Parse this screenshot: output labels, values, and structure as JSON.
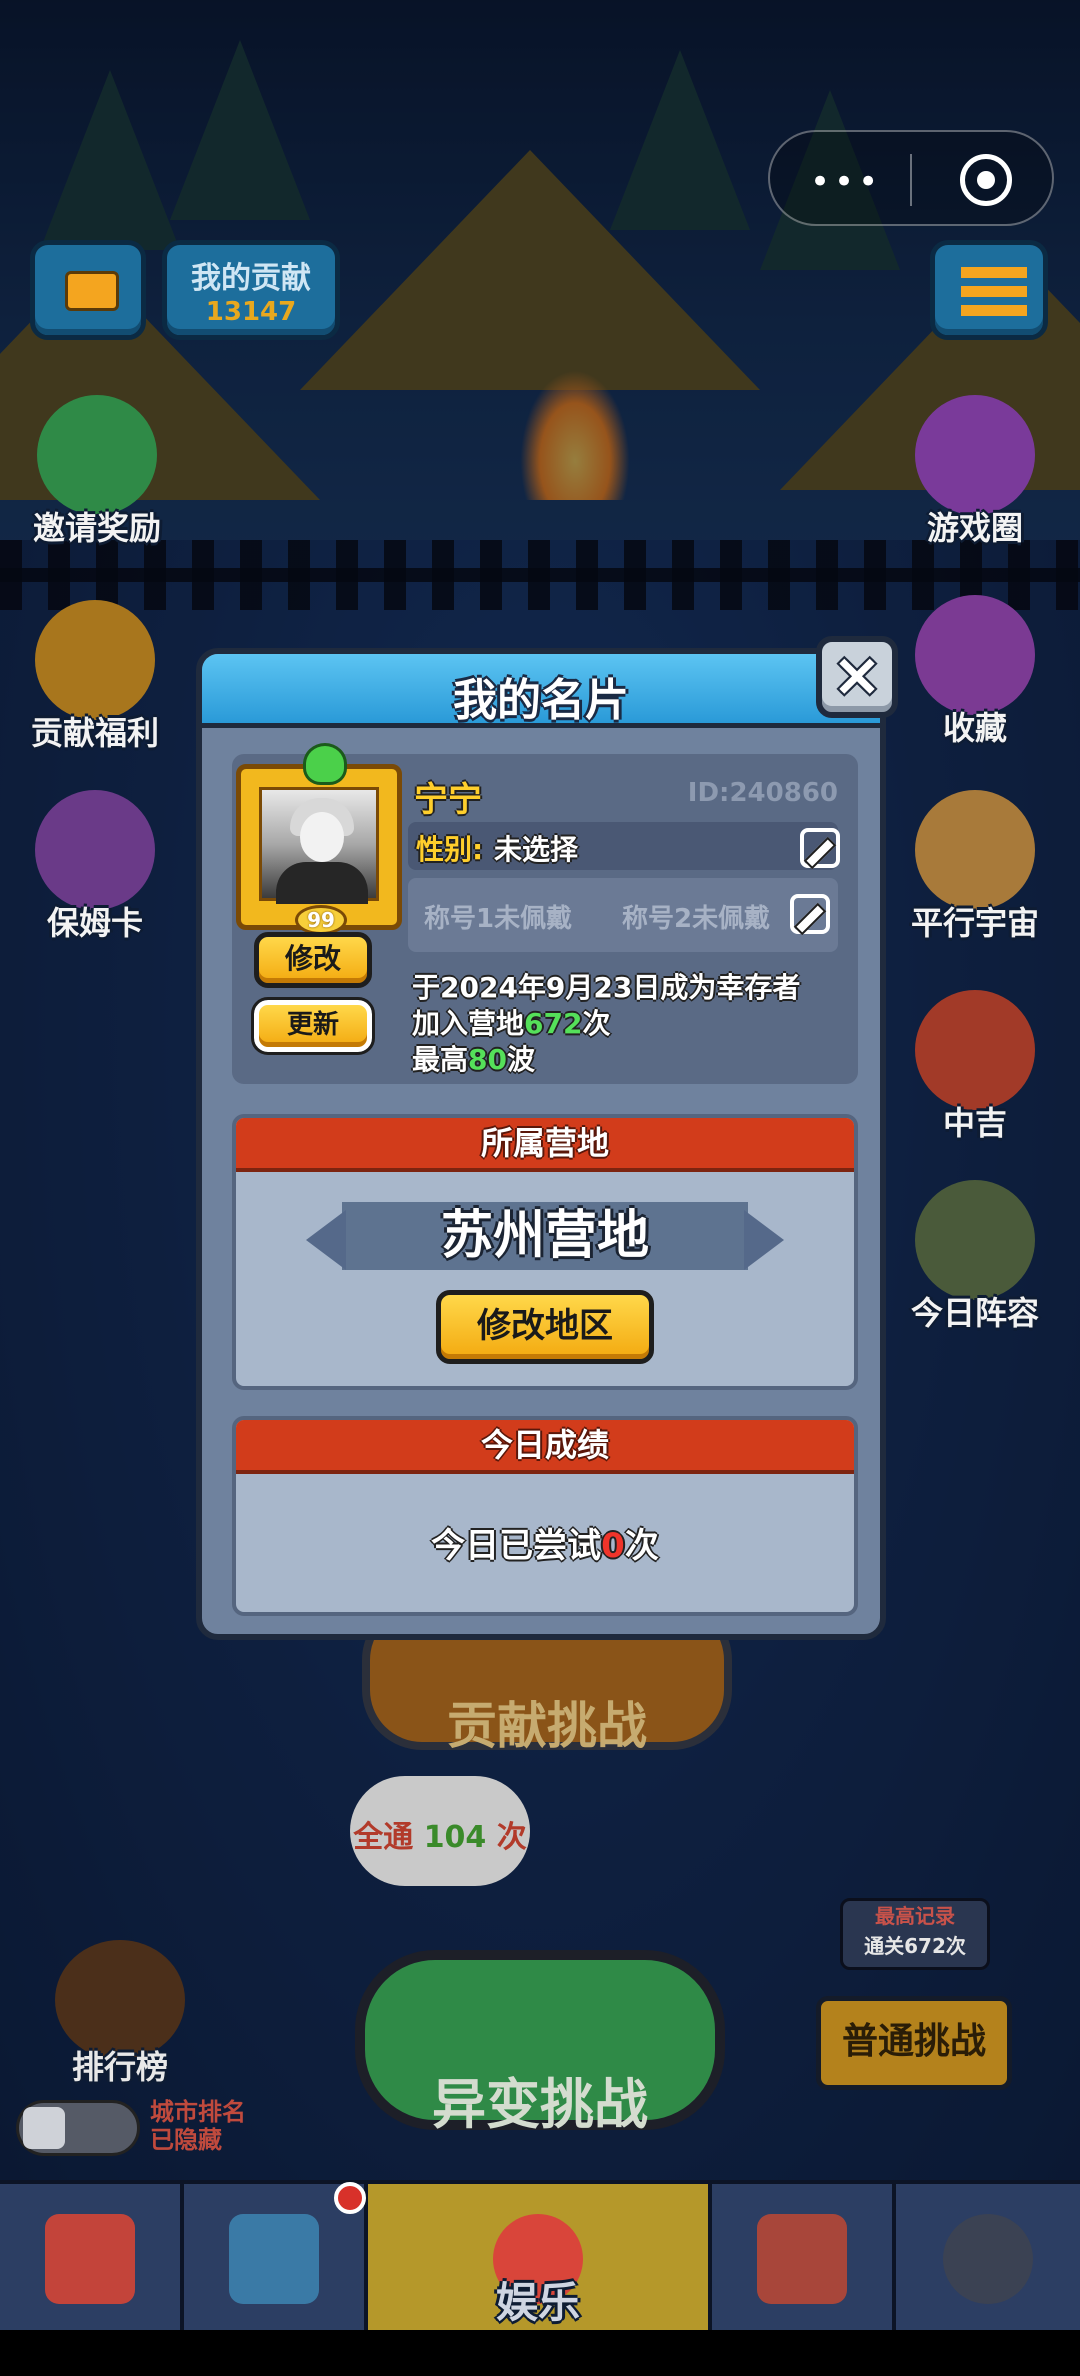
{
  "top": {
    "contribution_label": "我的贡献",
    "contribution_value": "13147"
  },
  "side_left": [
    {
      "label": "邀请奖励",
      "icon": "friends-icon"
    },
    {
      "label": "贡献福利",
      "icon": "star-shield-icon"
    },
    {
      "label": "保姆卡",
      "icon": "maid-icon"
    }
  ],
  "side_right": [
    {
      "label": "游戏圈",
      "icon": "group-icon"
    },
    {
      "label": "收藏",
      "icon": "book-icon"
    },
    {
      "label": "平行宇宙",
      "icon": "planet-icon"
    },
    {
      "label": "中吉",
      "icon": "fortune-icon"
    },
    {
      "label": "今日阵容",
      "icon": "lineup-icon"
    }
  ],
  "modal": {
    "title": "我的名片",
    "close_icon": "×",
    "profile": {
      "nickname": "宁宁",
      "id": "ID:240860",
      "level": "99",
      "gender_label": "性别:",
      "gender_value": "未选择",
      "title1": "称号1未佩戴",
      "title2": "称号2未佩戴",
      "edit_button": "修改",
      "refresh_button": "更新",
      "survivor_since": "于2024年9月23日成为幸存者",
      "join_prefix": "加入营地",
      "join_count": "672",
      "join_suffix": "次",
      "best_prefix": "最高",
      "best_wave": "80",
      "best_suffix": "波"
    },
    "camp": {
      "header": "所属营地",
      "name": "苏州营地",
      "change_button": "修改地区"
    },
    "today": {
      "header": "今日成绩",
      "prefix": "今日已尝试",
      "count": "0",
      "suffix": "次"
    }
  },
  "bottom": {
    "contribution_challenge": "贡献挑战",
    "bubble_prefix": "全通",
    "bubble_count": "104",
    "bubble_suffix": "次",
    "mutation_challenge": "异变挑战",
    "record_title": "最高记录",
    "record_value": "通关672次",
    "normal_challenge": "普通挑战",
    "leaderboard": "排行榜",
    "city_rank_line1": "城市排名",
    "city_rank_line2": "已隐藏"
  },
  "nav": {
    "tabs": [
      {
        "icon": "shop-icon",
        "label": ""
      },
      {
        "icon": "crossed-swords-icon",
        "label": ""
      },
      {
        "icon": "clown-icon",
        "label": "娱乐",
        "active": true
      },
      {
        "icon": "twins-icon",
        "label": ""
      },
      {
        "icon": "lock-icon",
        "label": ""
      }
    ]
  },
  "colors": {
    "modal_header": "#2a9ad8",
    "section_header": "#d23c1b",
    "button_yellow": "#f3a90f",
    "highlight_green": "#55e05a",
    "highlight_red": "#f0342a",
    "nickname_gold": "#ffcf2c"
  }
}
